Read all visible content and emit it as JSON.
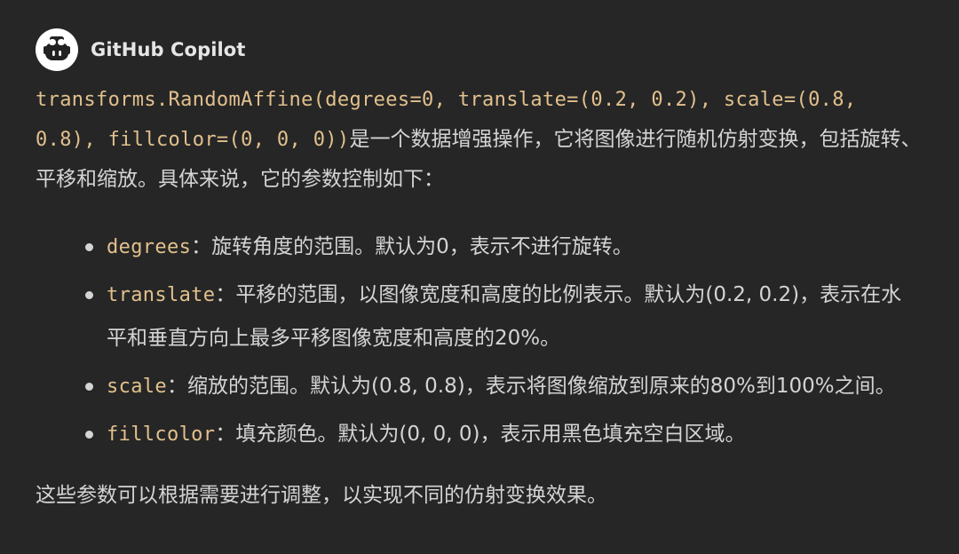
{
  "header": {
    "author": "GitHub Copilot",
    "avatar_icon": "copilot-icon"
  },
  "message": {
    "intro_code": "transforms.RandomAffine(degrees=0, translate=(0.2, 0.2), scale=(0.8, 0.8), fillcolor=(0, 0, 0))",
    "intro_text": "是一个数据增强操作，它将图像进行随机仿射变换，包括旋转、平移和缩放。具体来说，它的参数控制如下：",
    "params": [
      {
        "name": "degrees",
        "desc": "：旋转角度的范围。默认为0，表示不进行旋转。"
      },
      {
        "name": "translate",
        "desc": "：平移的范围，以图像宽度和高度的比例表示。默认为(0.2, 0.2)，表示在水平和垂直方向上最多平移图像宽度和高度的20%。"
      },
      {
        "name": "scale",
        "desc": "：缩放的范围。默认为(0.8, 0.8)，表示将图像缩放到原来的80%到100%之间。"
      },
      {
        "name": "fillcolor",
        "desc": "：填充颜色。默认为(0, 0, 0)，表示用黑色填充空白区域。"
      }
    ],
    "closing": "这些参数可以根据需要进行调整，以实现不同的仿射变换效果。"
  },
  "colors": {
    "background": "#262626",
    "text": "#d4d4d4",
    "code": "#e2c08d"
  }
}
